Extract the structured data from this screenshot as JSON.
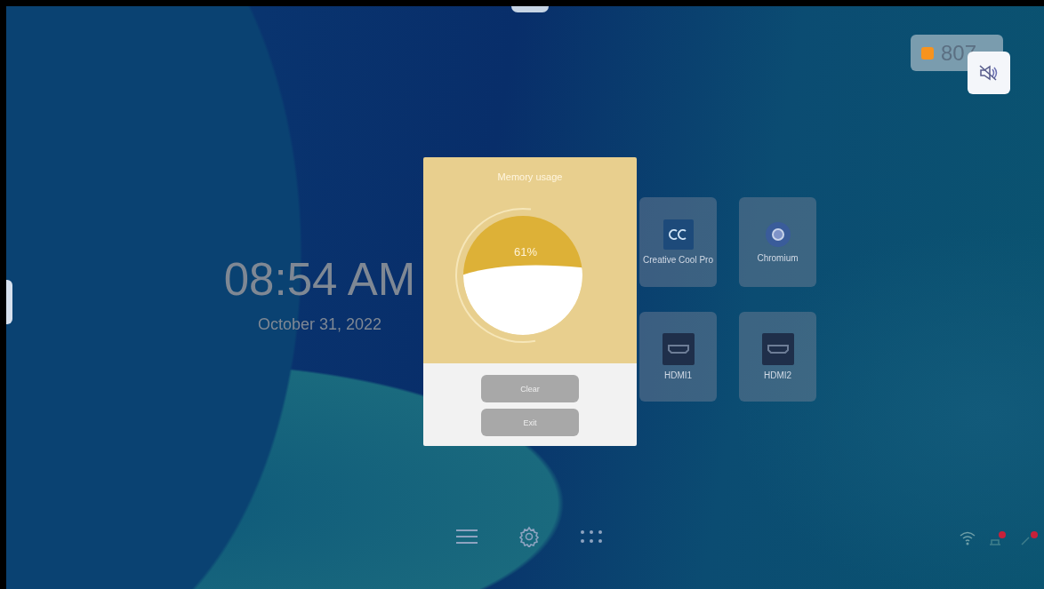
{
  "clock": {
    "time": "08:54 AM",
    "date": "October 31, 2022"
  },
  "apps": [
    {
      "label": "Creative Cool Pro",
      "kind": "cc"
    },
    {
      "label": "Chromium",
      "kind": "browser"
    },
    {
      "label": "HDMI1",
      "kind": "hdmi"
    },
    {
      "label": "HDMI2",
      "kind": "hdmi"
    }
  ],
  "status_badge": {
    "text": "807",
    "color": "#f7931e"
  },
  "memory_dialog": {
    "title": "Memory usage",
    "reading": "61%",
    "level": 0.61,
    "buttons": [
      "Clear",
      "Exit"
    ]
  }
}
